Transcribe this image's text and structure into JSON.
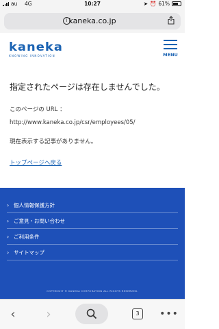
{
  "status_bar": {
    "carrier": "au",
    "network": "4G",
    "time": "10:27",
    "battery": "61%"
  },
  "browser": {
    "url": "kaneka.co.jp",
    "tab_count": "3"
  },
  "site": {
    "logo_text": "kaneka",
    "logo_tagline": "KNOWING INNOVATION",
    "menu_label": "MENU"
  },
  "content": {
    "heading": "指定されたページは存在しませんでした。",
    "url_label": "このページの URL ：",
    "url_value": "http://www.kaneka.co.jp/csr/employees/05/",
    "message": "現在表示する記事がありません。",
    "top_link": "トップページへ戻る"
  },
  "footer": {
    "links": [
      "個人情報保護方針",
      "ご意見・お問い合わせ",
      "ご利用条件",
      "サイトマップ"
    ],
    "copyright": "COPYRIGHT © KANEKA CORPORATION ALL RIGHTS RESERVED."
  },
  "colors": {
    "brand": "#1b63b3",
    "footer_bg": "#1e50b8"
  }
}
